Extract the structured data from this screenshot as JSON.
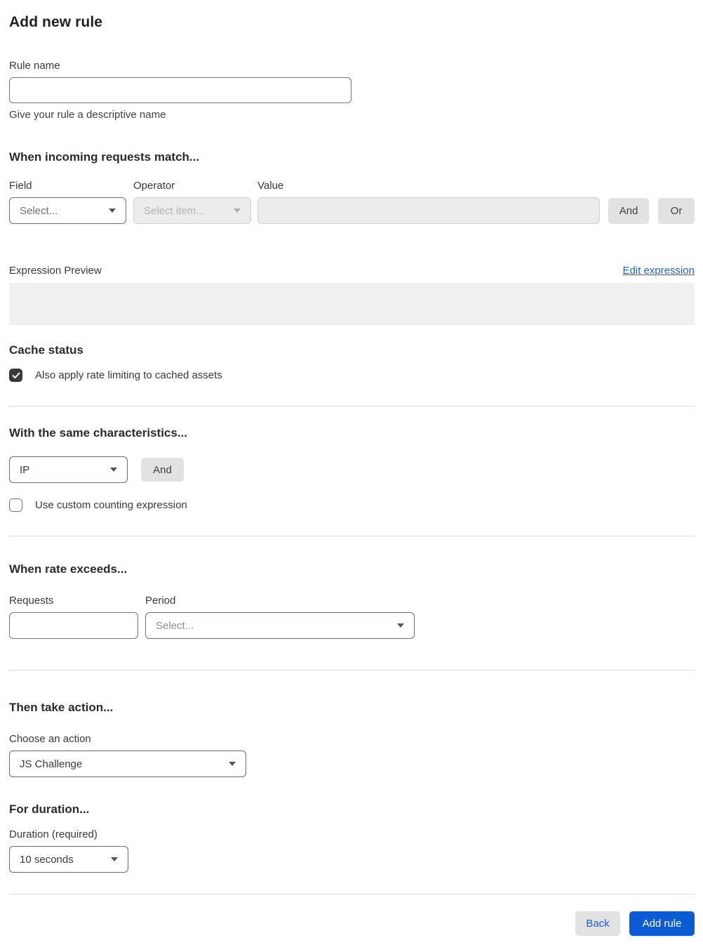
{
  "page": {
    "title": "Add new rule"
  },
  "rule_name": {
    "label": "Rule name",
    "value": "",
    "placeholder": "",
    "helper": "Give your rule a descriptive name"
  },
  "match_section": {
    "heading": "When incoming requests match...",
    "field": {
      "label": "Field",
      "selected": "Select..."
    },
    "operator": {
      "label": "Operator",
      "selected": "Select item...",
      "disabled": true
    },
    "value": {
      "label": "Value",
      "value": "",
      "placeholder": "",
      "disabled": true
    },
    "and_button": "And",
    "or_button": "Or",
    "expression_preview_label": "Expression Preview",
    "edit_expression_link": "Edit expression",
    "expression_value": ""
  },
  "cache_status": {
    "heading": "Cache status",
    "checkbox_label": "Also apply rate limiting to cached assets",
    "checked": true
  },
  "characteristics": {
    "heading": "With the same characteristics...",
    "select": {
      "selected": "IP"
    },
    "and_button": "And",
    "custom_counting_label": "Use custom counting expression",
    "custom_counting_checked": false
  },
  "rate": {
    "heading": "When rate exceeds...",
    "requests": {
      "label": "Requests",
      "value": "",
      "placeholder": ""
    },
    "period": {
      "label": "Period",
      "selected": "Select..."
    }
  },
  "action": {
    "heading": "Then take action...",
    "choose_label": "Choose an action",
    "selected": "JS Challenge"
  },
  "duration": {
    "heading": "For duration...",
    "label": "Duration (required)",
    "selected": "10 seconds"
  },
  "footer": {
    "back_button": "Back",
    "add_rule_button": "Add rule"
  },
  "colors": {
    "primary_blue": "#0b5bd3",
    "link_blue": "#1b62d0",
    "checkbox_checked": "#3a3a3a",
    "gray_button": "#e2e2e2",
    "disabled_bg": "#ececec",
    "preview_box": "#f0f0f0"
  }
}
